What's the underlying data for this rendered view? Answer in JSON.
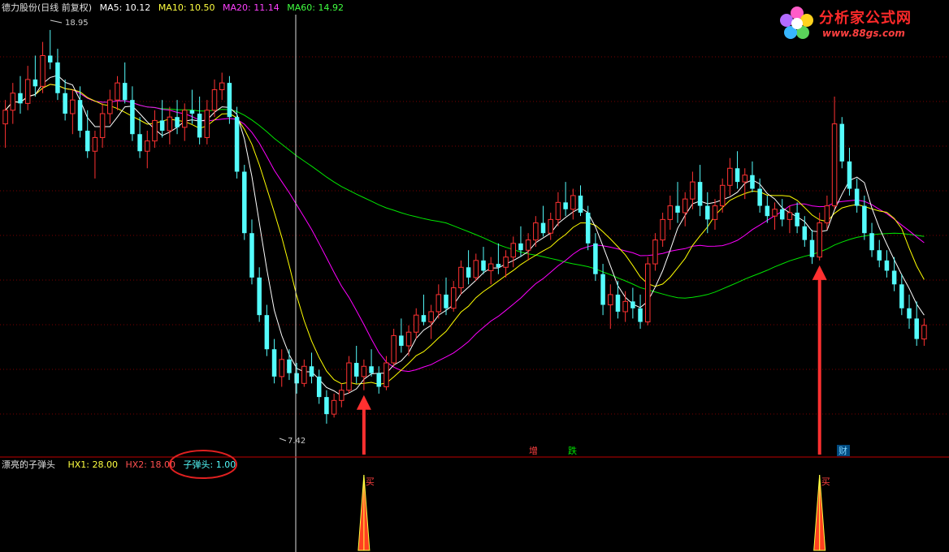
{
  "header": {
    "stock_name": "德力股份(日线 前复权)",
    "ma5": "MA5: 10.12",
    "ma10": "MA10: 10.50",
    "ma20": "MA20: 11.14",
    "ma60": "MA60: 14.92"
  },
  "logo": {
    "title": "分析家公式网",
    "url": "www.88gs.com"
  },
  "indicator": {
    "name": "漂亮的子弹头",
    "hx1": "HX1: 28.00",
    "hx2": "HX2: 18.00",
    "zdt": "子弹头: 1.00",
    "buy_label": "买"
  },
  "markers": {
    "increase": "增",
    "fall": "跌",
    "finance": "财"
  },
  "colors": {
    "up": "#ff3232",
    "down": "#54fcfc",
    "ma5": "#ffffff",
    "ma10": "#ffff00",
    "ma20": "#ff00ff",
    "ma60": "#00e600",
    "arrow": "#ff3030",
    "grid": "#7a0000"
  },
  "chart_data": {
    "type": "candlestick",
    "high_label": "18.95",
    "low_label": "7.42",
    "ylim": [
      6.8,
      19.4
    ],
    "candles": [
      [
        16.2,
        16.9,
        15.5,
        16.6
      ],
      [
        16.6,
        17.4,
        16.2,
        17.1
      ],
      [
        17.1,
        17.6,
        16.5,
        16.8
      ],
      [
        16.8,
        17.9,
        16.6,
        17.5
      ],
      [
        17.5,
        18.2,
        17.0,
        17.3
      ],
      [
        17.3,
        18.6,
        17.1,
        18.2
      ],
      [
        18.2,
        18.95,
        17.8,
        18.0
      ],
      [
        18.0,
        18.4,
        16.9,
        17.1
      ],
      [
        17.1,
        17.5,
        16.3,
        16.5
      ],
      [
        16.5,
        17.2,
        15.9,
        16.9
      ],
      [
        16.9,
        17.3,
        15.8,
        16.0
      ],
      [
        16.0,
        16.6,
        15.2,
        15.4
      ],
      [
        15.4,
        16.0,
        14.6,
        15.8
      ],
      [
        15.8,
        16.8,
        15.5,
        16.5
      ],
      [
        16.5,
        17.2,
        16.2,
        16.9
      ],
      [
        16.9,
        17.6,
        16.6,
        17.4
      ],
      [
        17.4,
        18.0,
        16.8,
        16.9
      ],
      [
        16.9,
        17.3,
        15.7,
        15.9
      ],
      [
        15.9,
        16.4,
        15.2,
        15.4
      ],
      [
        15.4,
        16.0,
        14.9,
        15.7
      ],
      [
        15.7,
        16.6,
        15.5,
        16.3
      ],
      [
        16.3,
        16.9,
        15.8,
        16.0
      ],
      [
        16.0,
        16.7,
        15.6,
        16.4
      ],
      [
        16.4,
        16.9,
        15.9,
        16.1
      ],
      [
        16.1,
        16.8,
        15.7,
        16.6
      ],
      [
        16.6,
        17.2,
        16.2,
        16.5
      ],
      [
        16.5,
        17.0,
        15.6,
        15.8
      ],
      [
        15.8,
        16.9,
        15.6,
        16.6
      ],
      [
        16.6,
        17.5,
        16.4,
        17.2
      ],
      [
        17.2,
        17.7,
        16.9,
        17.4
      ],
      [
        17.4,
        17.6,
        16.2,
        16.4
      ],
      [
        16.4,
        16.7,
        14.6,
        14.8
      ],
      [
        14.8,
        15.0,
        12.8,
        13.0
      ],
      [
        13.0,
        13.4,
        11.5,
        11.7
      ],
      [
        11.7,
        12.0,
        10.4,
        10.6
      ],
      [
        10.6,
        10.9,
        9.4,
        9.6
      ],
      [
        9.6,
        9.9,
        8.6,
        8.8
      ],
      [
        8.8,
        9.6,
        8.5,
        9.3
      ],
      [
        9.3,
        9.6,
        8.7,
        8.9
      ],
      [
        8.9,
        9.2,
        8.3,
        8.6
      ],
      [
        8.6,
        9.3,
        8.5,
        9.1
      ],
      [
        9.1,
        9.5,
        8.6,
        8.8
      ],
      [
        8.8,
        9.0,
        8.0,
        8.2
      ],
      [
        8.2,
        8.4,
        7.42,
        7.7
      ],
      [
        7.7,
        8.3,
        7.6,
        8.1
      ],
      [
        8.1,
        8.6,
        7.9,
        8.4
      ],
      [
        8.4,
        9.4,
        8.3,
        9.2
      ],
      [
        9.2,
        9.7,
        8.6,
        8.8
      ],
      [
        8.8,
        9.3,
        8.4,
        9.1
      ],
      [
        9.1,
        9.6,
        8.8,
        8.9
      ],
      [
        8.9,
        9.1,
        8.3,
        8.5
      ],
      [
        8.5,
        9.4,
        8.4,
        9.2
      ],
      [
        9.2,
        10.2,
        9.1,
        10.0
      ],
      [
        10.0,
        10.5,
        9.5,
        9.7
      ],
      [
        9.7,
        10.3,
        9.4,
        10.1
      ],
      [
        10.1,
        10.8,
        9.9,
        10.6
      ],
      [
        10.6,
        11.2,
        10.3,
        10.4
      ],
      [
        10.4,
        10.9,
        9.9,
        10.7
      ],
      [
        10.7,
        11.5,
        10.5,
        11.2
      ],
      [
        11.2,
        11.7,
        10.6,
        10.8
      ],
      [
        10.8,
        11.6,
        10.7,
        11.4
      ],
      [
        11.4,
        12.2,
        11.2,
        12.0
      ],
      [
        12.0,
        12.5,
        11.5,
        11.7
      ],
      [
        11.7,
        12.4,
        11.6,
        12.2
      ],
      [
        12.2,
        12.6,
        11.8,
        11.9
      ],
      [
        11.9,
        12.3,
        11.5,
        12.1
      ],
      [
        12.1,
        12.7,
        11.8,
        12.0
      ],
      [
        12.0,
        12.5,
        11.7,
        12.3
      ],
      [
        12.3,
        12.9,
        12.0,
        12.7
      ],
      [
        12.7,
        13.2,
        12.3,
        12.5
      ],
      [
        12.5,
        13.0,
        12.2,
        12.8
      ],
      [
        12.8,
        13.5,
        12.6,
        13.3
      ],
      [
        13.3,
        13.8,
        12.9,
        13.0
      ],
      [
        13.0,
        13.6,
        12.8,
        13.4
      ],
      [
        13.4,
        14.2,
        13.2,
        13.9
      ],
      [
        13.9,
        14.5,
        13.5,
        13.7
      ],
      [
        13.7,
        14.3,
        13.4,
        14.1
      ],
      [
        14.1,
        14.4,
        13.5,
        13.6
      ],
      [
        13.6,
        13.8,
        12.5,
        12.7
      ],
      [
        12.7,
        13.0,
        11.6,
        11.8
      ],
      [
        11.8,
        12.1,
        10.6,
        10.9
      ],
      [
        10.9,
        11.5,
        10.2,
        11.2
      ],
      [
        11.2,
        11.6,
        10.5,
        10.7
      ],
      [
        10.7,
        11.3,
        10.4,
        11.0
      ],
      [
        11.0,
        11.4,
        10.5,
        10.8
      ],
      [
        10.8,
        11.2,
        10.2,
        10.4
      ],
      [
        10.4,
        12.3,
        10.3,
        12.1
      ],
      [
        12.1,
        13.0,
        11.9,
        12.8
      ],
      [
        12.8,
        13.6,
        12.6,
        13.4
      ],
      [
        13.4,
        14.1,
        13.1,
        13.8
      ],
      [
        13.8,
        14.5,
        13.3,
        13.6
      ],
      [
        13.6,
        14.2,
        13.2,
        14.0
      ],
      [
        14.0,
        14.8,
        13.7,
        14.5
      ],
      [
        14.5,
        15.0,
        13.5,
        13.8
      ],
      [
        13.8,
        14.2,
        13.0,
        13.4
      ],
      [
        13.4,
        14.0,
        13.1,
        13.8
      ],
      [
        13.8,
        14.6,
        13.6,
        14.4
      ],
      [
        14.4,
        15.2,
        14.1,
        14.9
      ],
      [
        14.9,
        15.4,
        14.3,
        14.5
      ],
      [
        14.5,
        14.9,
        14.0,
        14.7
      ],
      [
        14.7,
        15.1,
        14.2,
        14.3
      ],
      [
        14.3,
        14.6,
        13.6,
        13.8
      ],
      [
        13.8,
        14.1,
        13.3,
        13.5
      ],
      [
        13.5,
        13.9,
        13.1,
        13.7
      ],
      [
        13.7,
        14.0,
        13.2,
        13.4
      ],
      [
        13.4,
        13.8,
        13.0,
        13.6
      ],
      [
        13.6,
        13.9,
        13.0,
        13.2
      ],
      [
        13.2,
        13.5,
        12.6,
        12.8
      ],
      [
        12.8,
        13.1,
        12.1,
        12.3
      ],
      [
        12.3,
        13.6,
        12.2,
        13.3
      ],
      [
        13.3,
        14.1,
        13.1,
        13.8
      ],
      [
        13.8,
        17.0,
        13.7,
        16.2
      ],
      [
        16.2,
        16.4,
        14.9,
        15.1
      ],
      [
        15.1,
        15.5,
        14.1,
        14.3
      ],
      [
        14.3,
        14.6,
        13.6,
        13.8
      ],
      [
        13.8,
        14.1,
        12.8,
        13.0
      ],
      [
        13.0,
        13.3,
        12.3,
        12.5
      ],
      [
        12.5,
        12.8,
        12.0,
        12.2
      ],
      [
        12.2,
        12.5,
        11.7,
        11.9
      ],
      [
        11.9,
        12.3,
        11.3,
        11.5
      ],
      [
        11.5,
        11.8,
        10.6,
        10.8
      ],
      [
        10.8,
        11.2,
        10.2,
        10.5
      ],
      [
        10.5,
        11.0,
        9.7,
        9.9
      ],
      [
        9.9,
        10.5,
        9.7,
        10.3
      ]
    ],
    "indicator_signals": [
      48,
      109
    ]
  }
}
